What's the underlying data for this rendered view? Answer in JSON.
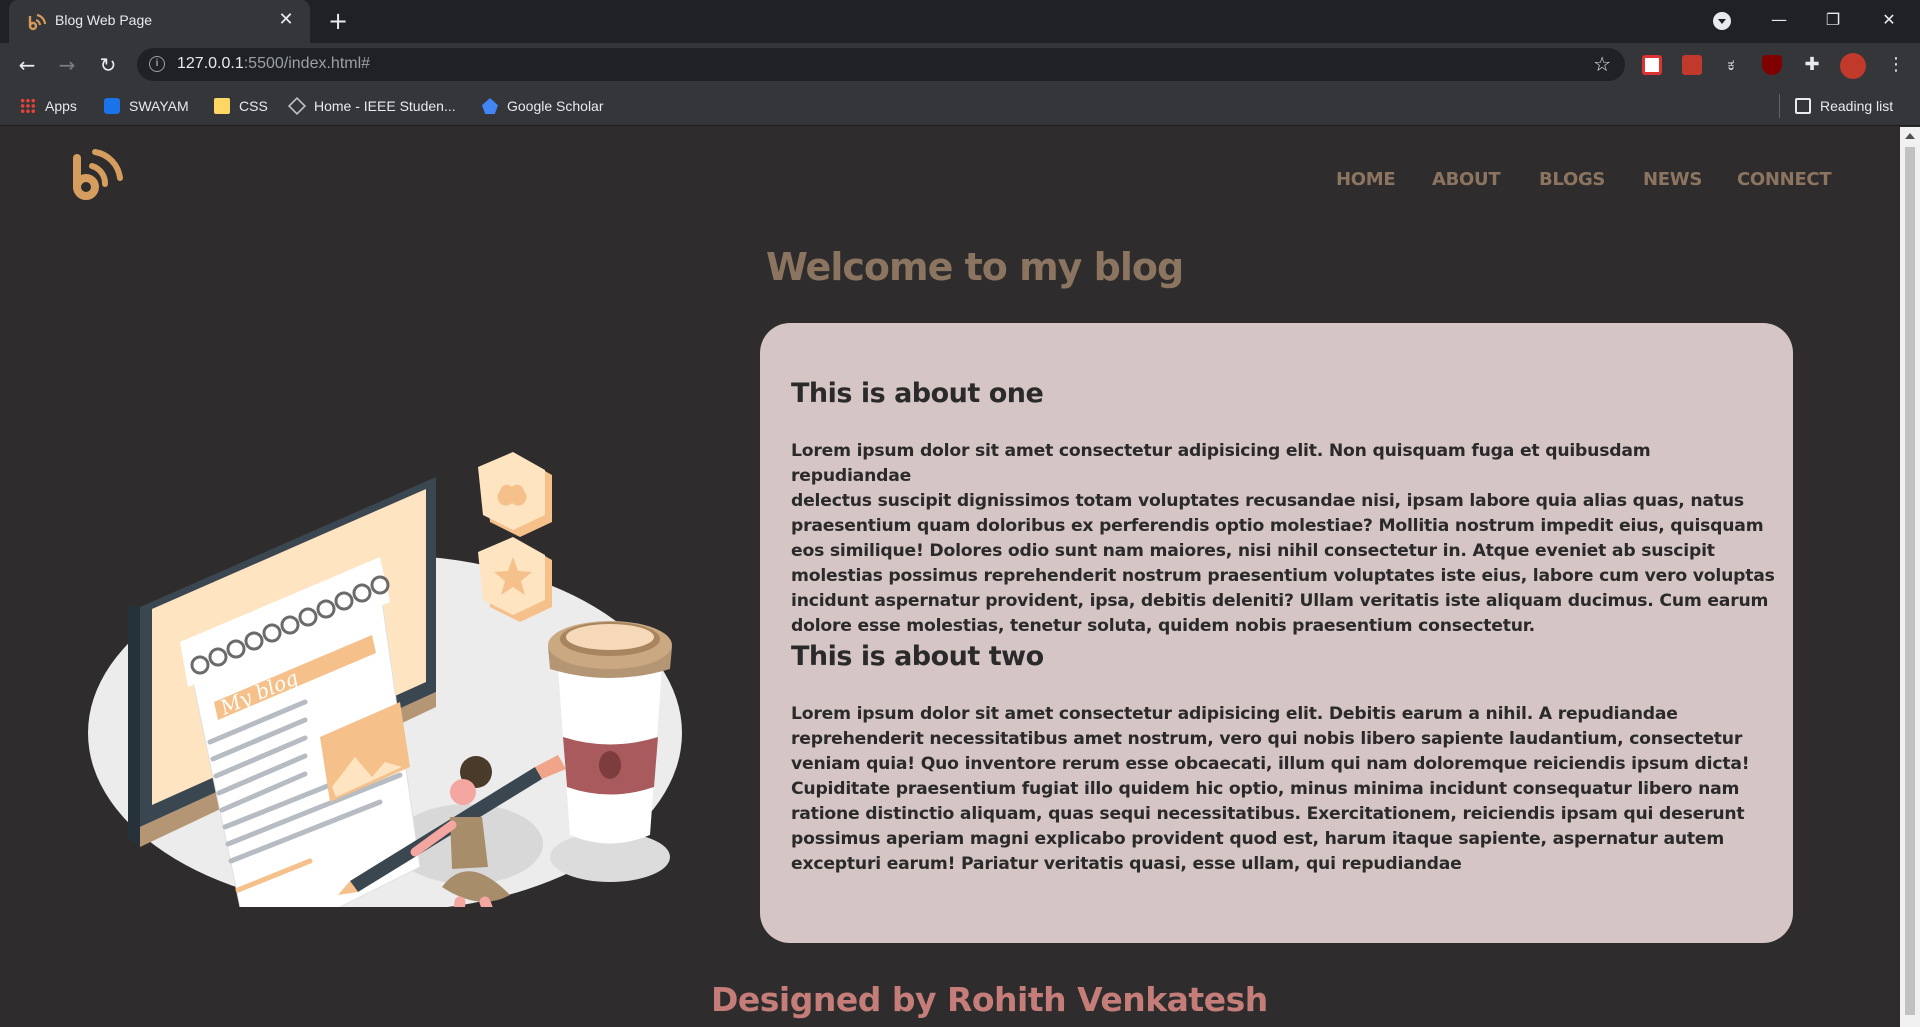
{
  "browser": {
    "tab_title": "Blog Web Page",
    "url_host": "127.0.0.1",
    "url_rest": ":5500/index.html#",
    "bookmarks": [
      {
        "label": "Apps",
        "icon": "apps-grid-icon"
      },
      {
        "label": "SWAYAM",
        "icon": "swayam-icon"
      },
      {
        "label": "CSS",
        "icon": "folder-icon"
      },
      {
        "label": "Home - IEEE Studen...",
        "icon": "ieee-diamond-icon"
      },
      {
        "label": "Google Scholar",
        "icon": "scholar-icon"
      }
    ],
    "reading_list": "Reading list"
  },
  "site": {
    "nav": [
      "HOME",
      "ABOUT",
      "BLOGS",
      "NEWS",
      "CONNECT"
    ],
    "welcome": "Welcome to my blog",
    "illustration_text": "My blog",
    "posts": [
      {
        "title": "This is about one",
        "lines": [
          "Lorem ipsum dolor sit amet consectetur adipisicing elit. Non quisquam fuga et quibusdam repudiandae",
          "delectus suscipit dignissimos totam voluptates recusandae nisi, ipsam labore quia alias quas, natus",
          "praesentium quam doloribus ex perferendis optio molestiae? Mollitia nostrum impedit eius, quisquam",
          "eos similique! Dolores odio sunt nam maiores, nisi nihil consectetur in. Atque eveniet ab suscipit",
          "molestias possimus reprehenderit nostrum praesentium voluptates iste eius, labore cum vero voluptas",
          "incidunt aspernatur provident, ipsa, debitis deleniti? Ullam veritatis iste aliquam ducimus. Cum earum",
          "dolore esse molestias, tenetur soluta, quidem nobis praesentium consectetur."
        ]
      },
      {
        "title": "This is about two",
        "lines": [
          "Lorem ipsum dolor sit amet consectetur adipisicing elit. Debitis earum a nihil. A repudiandae",
          "reprehenderit necessitatibus amet nostrum, vero qui nobis libero sapiente laudantium, consectetur",
          "veniam quia! Quo inventore rerum esse obcaecati, illum qui nam doloremque reiciendis ipsum dicta!",
          "Cupiditate praesentium fugiat illo quidem hic optio, minus minima incidunt consequatur libero nam",
          "ratione distinctio aliquam, quas sequi necessitatibus. Exercitationem, reiciendis ipsam qui deserunt",
          "possimus aperiam magni explicabo provident quod est, harum itaque sapiente, aspernatur autem",
          "excepturi earum! Pariatur veritatis quasi, esse ullam, qui repudiandae"
        ]
      }
    ],
    "footer": "Designed by Rohith Venkatesh"
  },
  "colors": {
    "page_bg": "#2e2c2c",
    "accent": "#8c7560",
    "card_bg": "#d5c5c5",
    "footer": "#c47d78"
  }
}
